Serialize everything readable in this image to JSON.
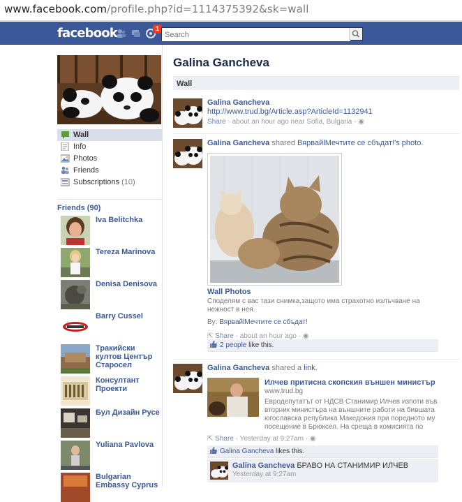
{
  "browser": {
    "url_domain": "www.facebook.com",
    "url_path": "/profile.php?id=1114375392&sk=wall"
  },
  "header": {
    "logo": "facebook",
    "notification_count": "1",
    "search_placeholder": "Search"
  },
  "profile": {
    "name": "Galina Gancheva",
    "section_title": "Wall"
  },
  "nav": {
    "items": [
      {
        "label": "Wall",
        "icon": "wall-icon"
      },
      {
        "label": "Info",
        "icon": "info-icon"
      },
      {
        "label": "Photos",
        "icon": "photos-icon"
      },
      {
        "label": "Friends",
        "icon": "friends-icon"
      },
      {
        "label": "Subscriptions",
        "count": "(10)",
        "icon": "subscriptions-icon"
      }
    ]
  },
  "friends": {
    "heading": "Friends (90)",
    "list": [
      {
        "name": "Iva Belitchka"
      },
      {
        "name": "Tereza Marinova"
      },
      {
        "name": "Denisa Denisova"
      },
      {
        "name": "Barry Cussel"
      },
      {
        "name": "Тракийски култов Център Старосел"
      },
      {
        "name": "Консултант Проекти"
      },
      {
        "name": "Бул Дизайн Русе"
      },
      {
        "name": "Yuliana Pavlova"
      },
      {
        "name": "Bulgarian Embassy Cyprus"
      }
    ]
  },
  "stories": [
    {
      "author": "Galina Gancheva",
      "link": "http://www.trud.bg/Article.asp?ArticleId=1132941",
      "share": "Share",
      "meta": " · about an hour ago near Sofia, Bulgaria · "
    },
    {
      "author": "Galina Gancheva",
      "action": " shared ",
      "target": "ВярвайlМечтите се сбъдат!'s photo.",
      "album": "Wall Photos",
      "caption": "Споделям с вас тази снимка,защото има страхотно излъчване на нежност в нея.",
      "via_label": "By: ",
      "via": "ВярвайlМечтите се сбъдат!",
      "share": "Share",
      "meta": " · about an hour ago · ",
      "likes_link": "2 people",
      "likes_text": " like this."
    },
    {
      "author": "Galina Gancheva",
      "action": " shared a ",
      "target": "link.",
      "article_title": "Илчев притисна скопския външен министър",
      "article_domain": "www.trud.bg",
      "article_excerpt": "Евродепутатът от НДСВ Станимир Илчев изпоти във вторник министъра на външните работи на бившата югославска република Македония при поредното му посещение в Брюксел. На среща в комисията по външни",
      "share": "Share",
      "meta": " · Yesterday at 9:27am · ",
      "likes_link": "Galina Gancheva",
      "likes_text": " likes this.",
      "comment_author": "Galina Gancheva",
      "comment_text": " БРАВО НА СТАНИМИР ИЛЧЕВ",
      "comment_time": "Yesterday at 9:27am"
    }
  ],
  "colors": {
    "brand": "#3b5998",
    "link": "#3b5998",
    "meta": "#999999",
    "badge": "#f03d25"
  }
}
